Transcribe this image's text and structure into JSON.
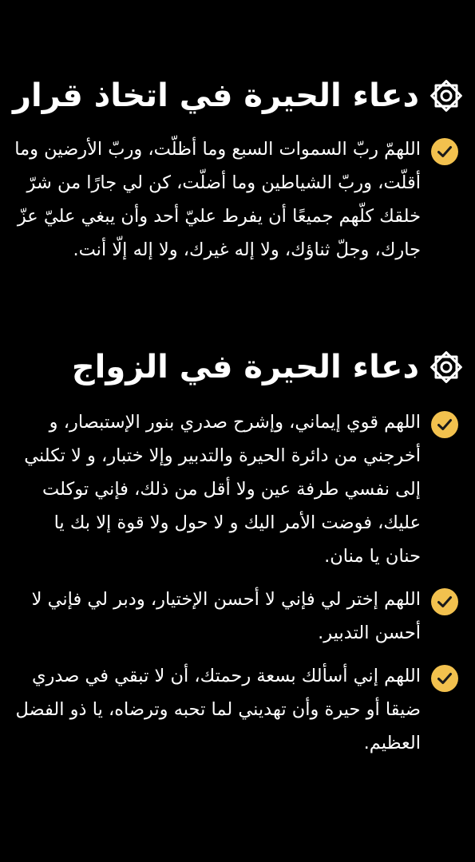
{
  "colors": {
    "background": "#000000",
    "text": "#ffffff",
    "check_fill": "#f2c14e",
    "check_mark": "#1a1a1a"
  },
  "sections": [
    {
      "icon": "ornament-star-icon",
      "title": "دعاء الحيرة في اتخاذ قرار",
      "items": [
        {
          "icon": "check-circle-icon",
          "text": "اللهمّ ربّ السموات السبع وما أظلّت، وربّ الأرضين وما أقلّت، وربّ الشياطين وما أضلّت، كن لي جارًا من شرّ خلقك كلّهم جميعًا أن يفرط عليّ أحد وأن يبغي عليّ عزّ جارك، وجلّ ثناؤك، ولا إله غيرك، ولا إله إلّا أنت."
        }
      ]
    },
    {
      "icon": "ornament-star-icon",
      "title": "دعاء الحيرة في الزواج",
      "items": [
        {
          "icon": "check-circle-icon",
          "text": "اللهم قوي إيماني، وإشرح صدري بنور الإستبصار، و أخرجني من دائرة الحيرة والتدبير وإلا ختبار، و لا تكلني إلى نفسي طرفة عين ولا أقل من ذلك، فإني توكلت عليك، فوضت الأمر اليك و لا حول ولا قوة إلا بك يا حنان يا منان."
        },
        {
          "icon": "check-circle-icon",
          "text": "اللهم إختر لي فإني لا أحسن الإختيار، ودبر لي فإني لا أحسن التدبير."
        },
        {
          "icon": "check-circle-icon",
          "text": "اللهم إني أسألك بسعة رحمتك، أن لا تبقي في صدري ضيقا أو حيرة وأن تهديني لما تحبه وترضاه، يا ذو الفضل العظيم."
        }
      ]
    }
  ]
}
